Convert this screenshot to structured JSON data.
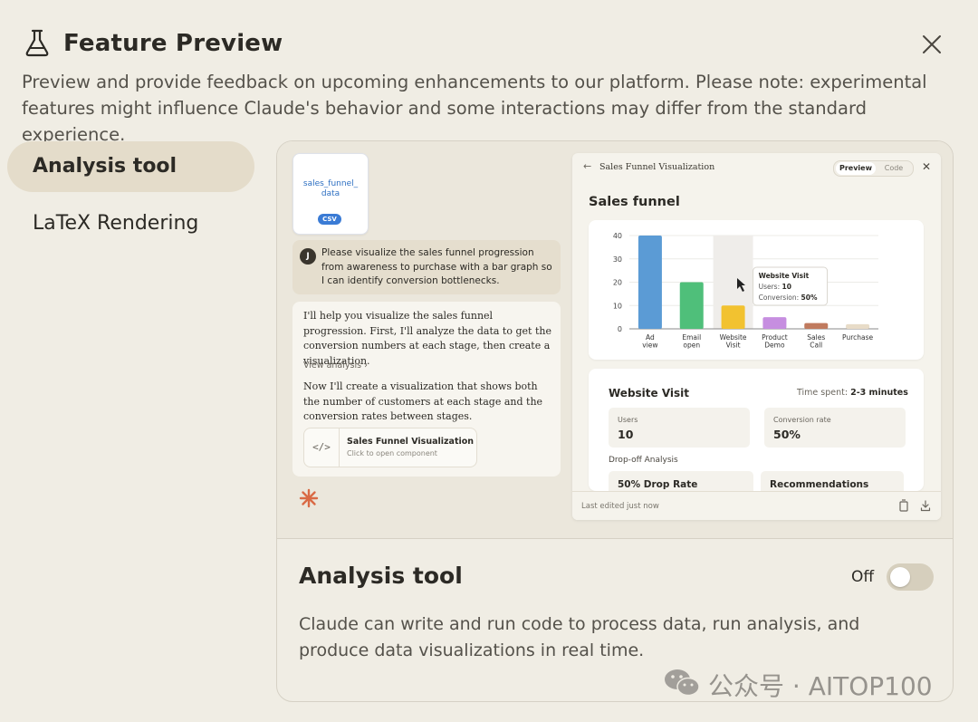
{
  "header": {
    "title": "Feature Preview",
    "description": "Preview and provide feedback on upcoming enhancements to our platform. Please note: experimental features might influence Claude's behavior and some interactions may differ from the standard experience."
  },
  "sidebar": {
    "items": [
      {
        "label": "Analysis tool",
        "active": true
      },
      {
        "label": "LaTeX Rendering",
        "active": false
      }
    ]
  },
  "preview": {
    "file": {
      "name": "sales_funnel_\ndata",
      "type": "CSV"
    },
    "user_avatar": "J",
    "user_message": "Please visualize the sales funnel progression from awareness to purchase with a bar graph so I can identify conversion bottlenecks.",
    "response_1": "I'll help you visualize the sales funnel progression. First, I'll analyze the data to get the conversion numbers at each stage, then create a visualization.",
    "view_analysis": "View analysis",
    "response_2": "Now I'll create a visualization that shows both the number of customers at each stage and the conversion rates between stages.",
    "artifact": {
      "title": "Sales Funnel Visualization",
      "subtitle": "Click to open component",
      "icon": "code-icon"
    },
    "window": {
      "title": "Sales Funnel Visualization",
      "tabs": [
        "Preview",
        "Code"
      ],
      "heading": "Sales funnel",
      "tooltip": {
        "title": "Website Visit",
        "users_label": "Users:",
        "users_value": "10",
        "conv_label": "Conversion:",
        "conv_value": "50%"
      },
      "stat": {
        "title": "Website Visit",
        "time_label": "Time spent:",
        "time_value": "2-3 minutes",
        "metrics": [
          {
            "label": "Users",
            "value": "10"
          },
          {
            "label": "Conversion rate",
            "value": "50%"
          }
        ],
        "dropoff_label": "Drop-off Analysis",
        "drop_rate": "50% Drop Rate",
        "recommendations": "Recommendations"
      },
      "footer": "Last edited just now"
    }
  },
  "feature": {
    "title": "Analysis tool",
    "toggle_label": "Off",
    "toggle_on": false,
    "description": "Claude can write and run code to process data, run analysis, and produce data visualizations in real time."
  },
  "watermark": "公众号 · AITOP100",
  "chart_data": {
    "type": "bar",
    "title": "Sales funnel",
    "categories": [
      "Ad view",
      "Email open",
      "Website Visit",
      "Product Demo",
      "Sales Call",
      "Purchase"
    ],
    "values": [
      40,
      20,
      10,
      5,
      2.5,
      2
    ],
    "colors": [
      "#5b9bd5",
      "#4fbf7a",
      "#f2c230",
      "#c68ee0",
      "#c07a5e",
      "#e8dcc8"
    ],
    "ylim": [
      0,
      40
    ],
    "yticks": [
      0,
      10,
      20,
      30,
      40
    ],
    "highlighted": "Website Visit"
  }
}
